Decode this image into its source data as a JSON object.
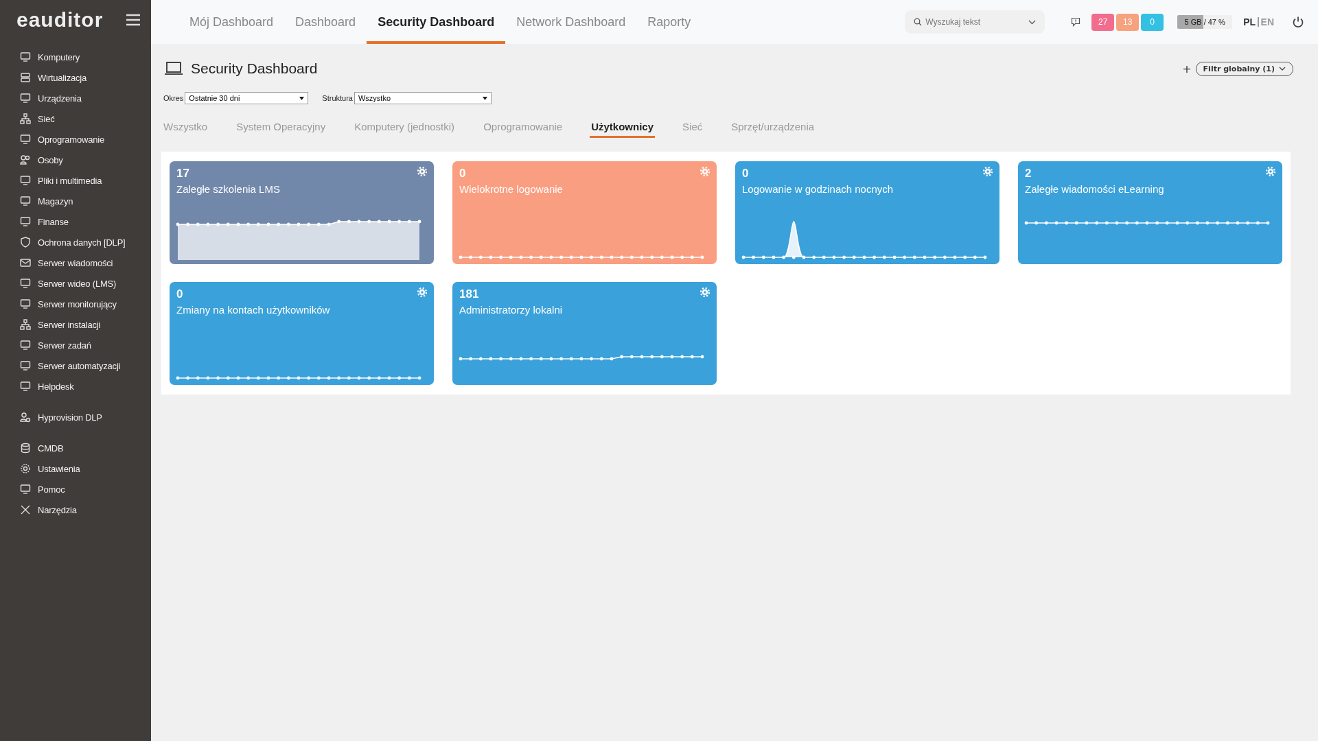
{
  "logo": "eauditor",
  "sidebar": {
    "groups": [
      {
        "items": [
          "Komputery",
          "Wirtualizacja",
          "Urządzenia",
          "Sieć",
          "Oprogramowanie",
          "Osoby",
          "Pliki i multimedia",
          "Magazyn",
          "Finanse",
          "Ochrona danych [DLP]",
          "Serwer wiadomości",
          "Serwer wideo (LMS)",
          "Serwer monitorujący",
          "Serwer instalacji",
          "Serwer zadań",
          "Serwer automatyzacji",
          "Helpdesk"
        ]
      },
      {
        "items": [
          "Hyprovision DLP"
        ]
      },
      {
        "items": [
          "CMDB",
          "Ustawienia",
          "Pomoc",
          "Narzędzia"
        ]
      }
    ]
  },
  "top_tabs": [
    {
      "label": "Mój Dashboard",
      "selected": false
    },
    {
      "label": "Dashboard",
      "selected": false
    },
    {
      "label": "Security Dashboard",
      "selected": true
    },
    {
      "label": "Network Dashboard",
      "selected": false
    },
    {
      "label": "Raporty",
      "selected": false
    }
  ],
  "search": {
    "placeholder": "Wyszukaj tekst"
  },
  "badges": [
    {
      "text": "27",
      "color": "#f26d8d"
    },
    {
      "text": "13",
      "color": "#f7a27e"
    },
    {
      "text": "0",
      "color": "#33c0e3"
    }
  ],
  "storage": {
    "used": "5 GB",
    "reading": "/ 47 %",
    "level": 0.47
  },
  "languages": [
    {
      "label": "PL",
      "selected": true
    },
    {
      "label": "EN",
      "selected": false
    }
  ],
  "page_title": "Security Dashboard",
  "global_filter": {
    "add": "+",
    "label": "Filtr globalny (1)"
  },
  "filters": [
    {
      "label": "Okres",
      "value": "Ostatnie 30 dni"
    },
    {
      "label": "Struktura",
      "value": "Wszystko"
    }
  ],
  "tabs": [
    {
      "label": "Wszystko",
      "selected": false
    },
    {
      "label": "System Operacyjny",
      "selected": false
    },
    {
      "label": "Komputery (jednostki)",
      "selected": false
    },
    {
      "label": "Oprogramowanie",
      "selected": false
    },
    {
      "label": "Użytkownicy",
      "selected": true
    },
    {
      "label": "Sieć",
      "selected": false
    },
    {
      "label": "Sprzęt/urządzenia",
      "selected": false
    }
  ],
  "cards": [
    {
      "value": "17",
      "title": "Zaległe szkolenia LMS",
      "color": "#7288aa",
      "kind": "area"
    },
    {
      "value": "0",
      "title": "Wielokrotne logowanie",
      "color": "#fa9e82",
      "kind": "flat"
    },
    {
      "value": "0",
      "title": "Logowanie w godzinach nocnych",
      "color": "#3aa1da",
      "kind": "spike"
    },
    {
      "value": "2",
      "title": "Zaległe wiadomości eLearning",
      "color": "#3aa1da",
      "kind": "high"
    },
    {
      "value": "0",
      "title": "Zmiany na kontach użytkowników",
      "color": "#3aa1da",
      "kind": "flat"
    },
    {
      "value": "181",
      "title": "Administratorzy lokalni",
      "color": "#3aa1da",
      "kind": "step"
    }
  ]
}
